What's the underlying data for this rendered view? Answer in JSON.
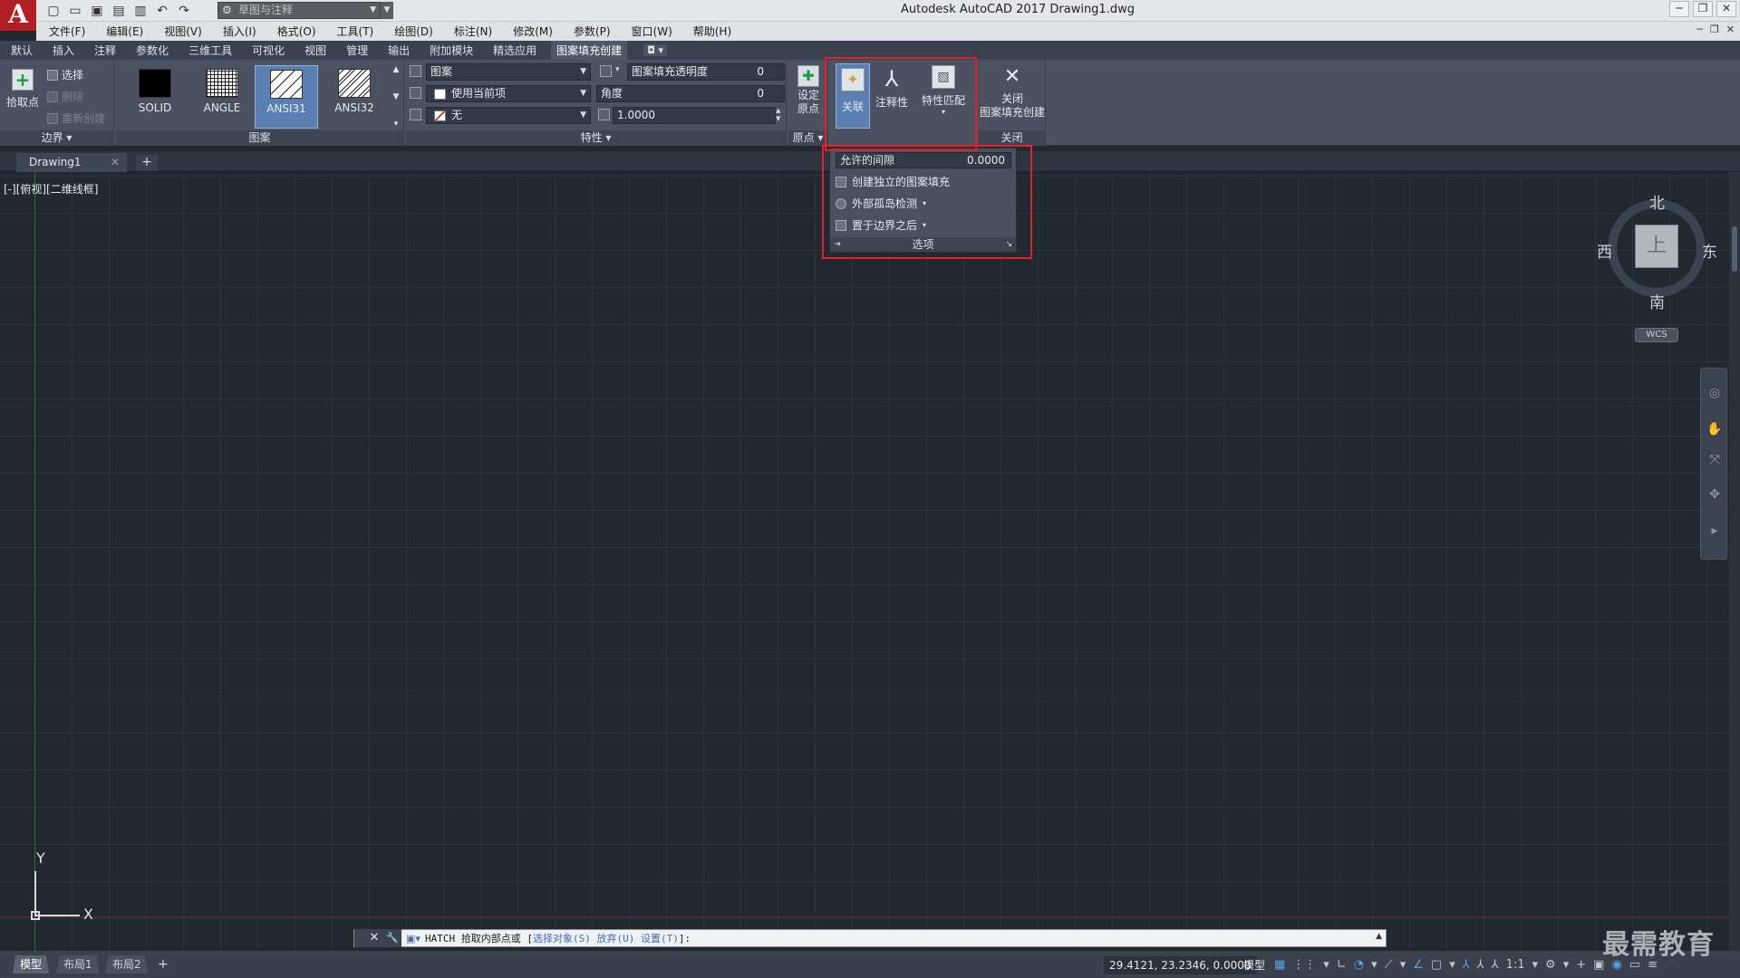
{
  "app": {
    "title": "Autodesk AutoCAD 2017    Drawing1.dwg",
    "logo": "A"
  },
  "quick_access": {
    "workspace": "草图与注释",
    "icons": [
      "new-icon",
      "open-icon",
      "save-icon",
      "saveas-icon",
      "print-icon",
      "undo-icon",
      "redo-icon"
    ]
  },
  "menu": [
    "文件(F)",
    "编辑(E)",
    "视图(V)",
    "插入(I)",
    "格式(O)",
    "工具(T)",
    "绘图(D)",
    "标注(N)",
    "修改(M)",
    "参数(P)",
    "窗口(W)",
    "帮助(H)"
  ],
  "ribbon_tabs": [
    "默认",
    "插入",
    "注释",
    "参数化",
    "三维工具",
    "可视化",
    "视图",
    "管理",
    "输出",
    "附加模块",
    "精选应用",
    "图案填充创建"
  ],
  "ribbon_active_tab": "图案填充创建",
  "boundary_panel": {
    "title": "边界",
    "pick_points": "拾取点",
    "select": "选择",
    "remove": "删除",
    "recreate": "重新创建"
  },
  "pattern_panel": {
    "title": "图案",
    "patterns": [
      "SOLID",
      "ANGLE",
      "ANSI31",
      "ANSI32"
    ],
    "selected": "ANSI31"
  },
  "properties_panel": {
    "title": "特性",
    "type": "图案",
    "color": "使用当前项",
    "background": "无",
    "transparency_label": "图案填充透明度",
    "transparency_value": "0",
    "angle_label": "角度",
    "angle_value": "0",
    "scale_value": "1.0000"
  },
  "origin_panel": {
    "title": "原点",
    "set_origin": "设定\n原点",
    "set_origin_l1": "设定",
    "set_origin_l2": "原点"
  },
  "options_panel": {
    "associative": "关联",
    "annotative": "注释性",
    "match_properties": "特性匹配",
    "gap_label": "允许的间隙",
    "gap_value": "0.0000",
    "separate_hatches": "创建独立的图案填充",
    "island_detection": "外部孤岛检测",
    "draw_order": "置于边界之后",
    "title": "选项"
  },
  "close_panel": {
    "title": "关闭",
    "close_l1": "关闭",
    "close_l2": "图案填充创建"
  },
  "file_tabs": {
    "active": "Drawing1"
  },
  "viewport_label": "[-][俯视][二维线框]",
  "viewcube": {
    "north": "北",
    "south": "南",
    "east": "东",
    "west": "西",
    "face": "上",
    "wcs": "WCS"
  },
  "ucs": {
    "x": "X",
    "y": "Y"
  },
  "command_line": {
    "command": "HATCH",
    "prompt": " 拾取内部点或 [",
    "opt1": "选择对象(S)",
    "opt2": "放弃(U)",
    "opt3": "设置(T)",
    "tail": "]:"
  },
  "layout_tabs": [
    "模型",
    "布局1",
    "布局2"
  ],
  "status": {
    "coords": "29.4121, 23.2346, 0.0000",
    "model": "模型",
    "scale": "1:1"
  },
  "watermark": "最需教育"
}
